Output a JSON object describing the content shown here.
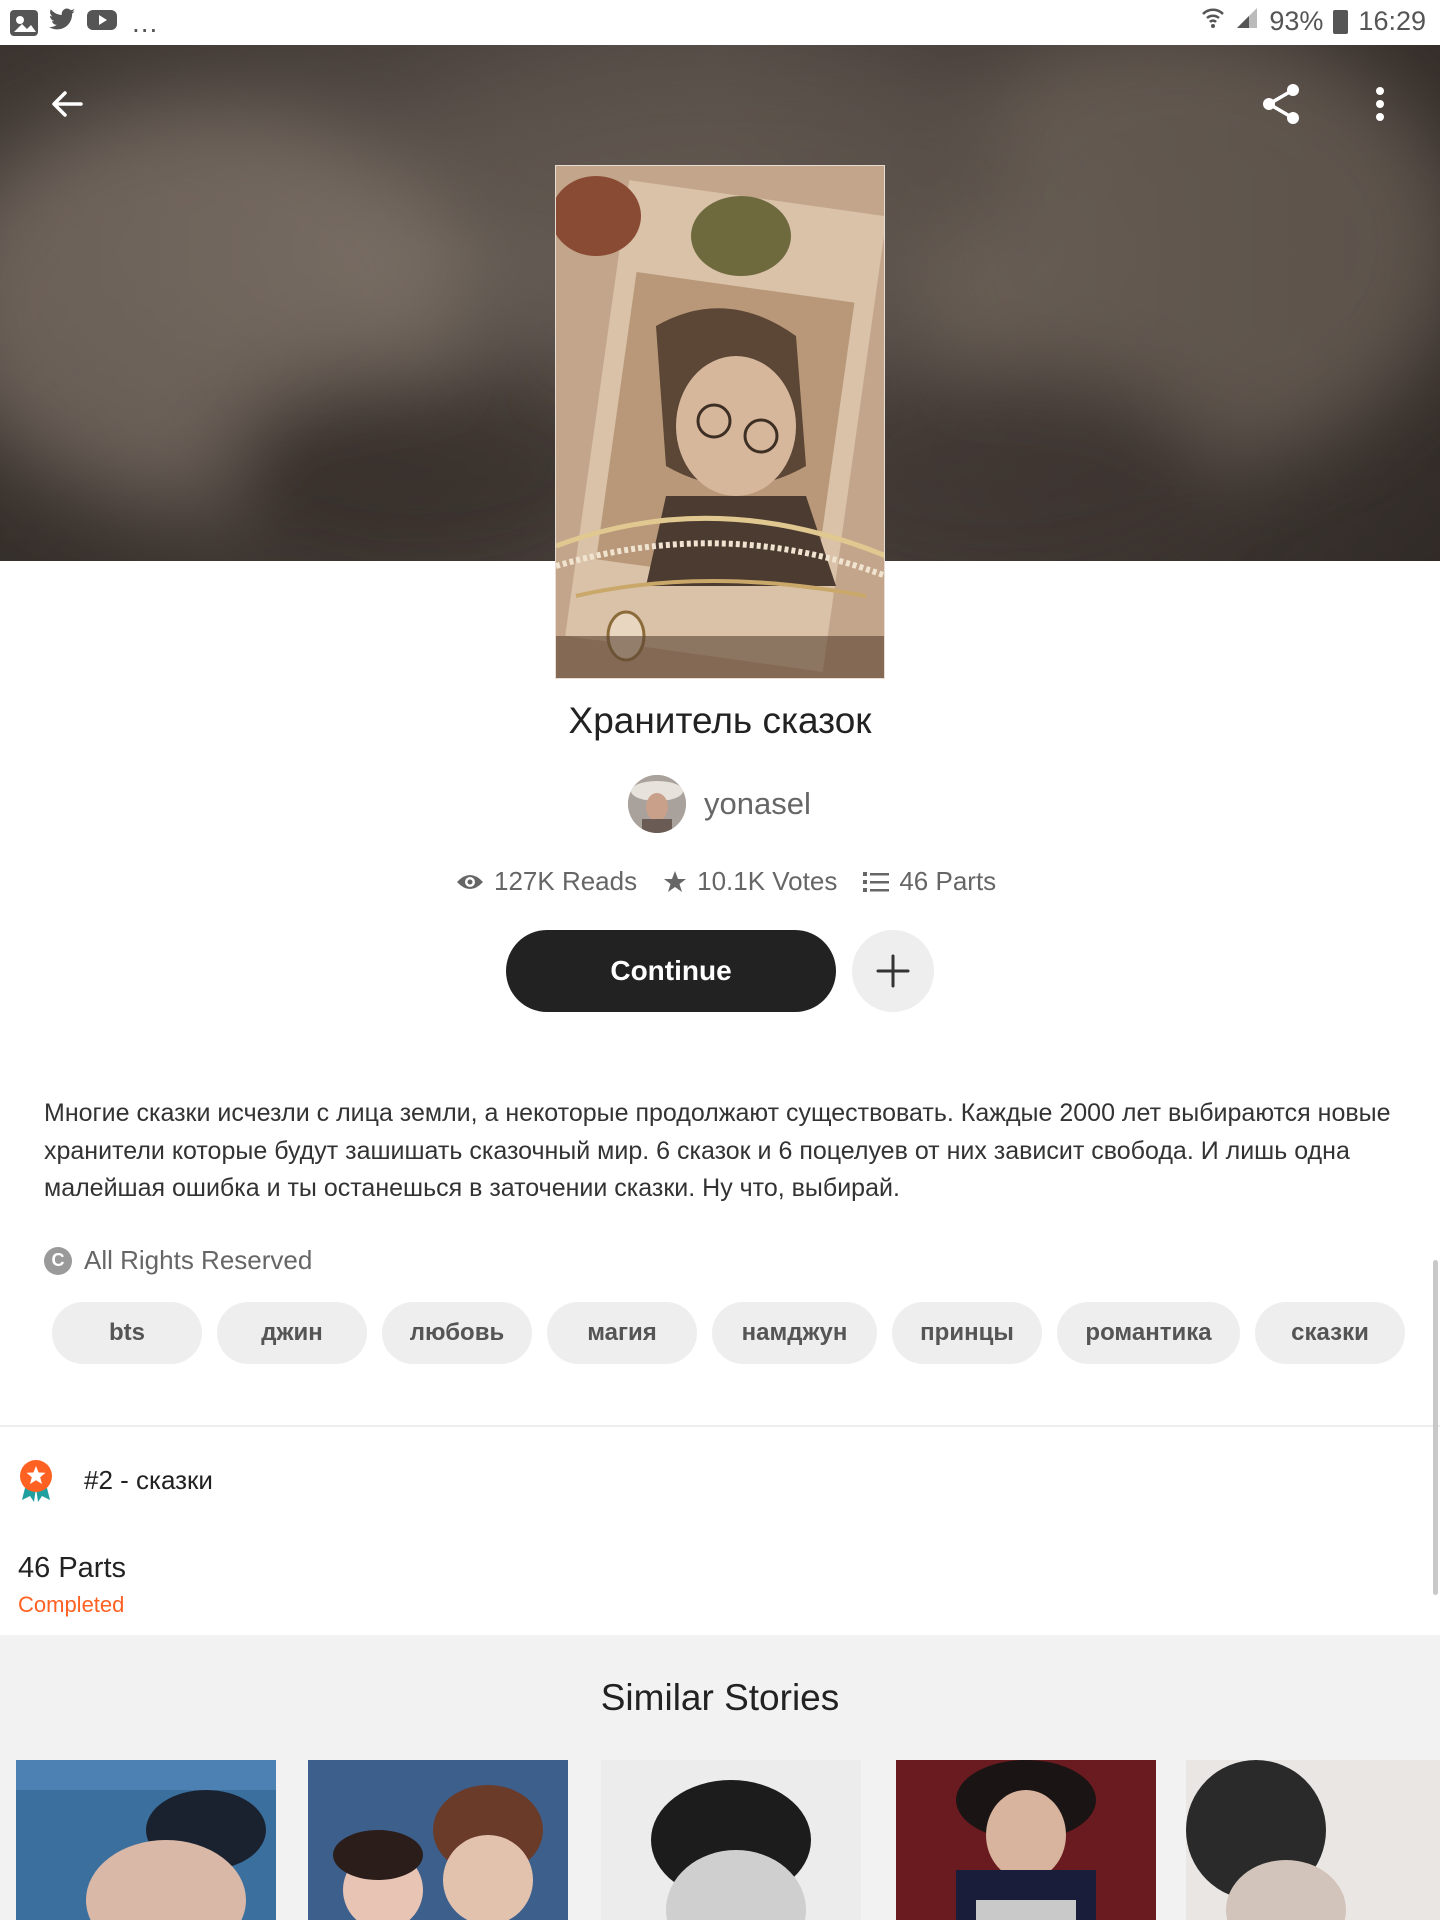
{
  "status_bar": {
    "left_icons": [
      "gallery-icon",
      "twitter-icon",
      "youtube-icon"
    ],
    "overflow": "...",
    "battery": "93%",
    "time": "16:29"
  },
  "header": {
    "back_icon": "arrow-back-icon",
    "share_icon": "share-icon",
    "more_icon": "more-vert-icon"
  },
  "story": {
    "title": "Хранитель сказок",
    "author": "yonasel",
    "reads": "127K Reads",
    "votes": "10.1K Votes",
    "parts": "46 Parts",
    "continue_label": "Continue",
    "description": "Многие сказки исчезли с лица земли, а некоторые продолжают существовать. Каждые 2000 лет выбираются новые хранители которые будут зашишать сказочный мир. 6 сказок и 6 поцелуев от них зависит свобода. И лишь одна малейшая ошибка и ты останешься в заточении сказки. Ну что, выбирай.",
    "copyright": "All Rights Reserved",
    "tags": [
      "bts",
      "джин",
      "любовь",
      "магия",
      "намджун",
      "принцы",
      "романтика",
      "сказки"
    ],
    "rank": "#2 - сказки",
    "parts_count": "46 Parts",
    "status": "Completed"
  },
  "similar": {
    "title": "Similar Stories"
  },
  "colors": {
    "accent": "#ff6122",
    "button_dark": "#222222",
    "tag_bg": "#eeeeee"
  }
}
